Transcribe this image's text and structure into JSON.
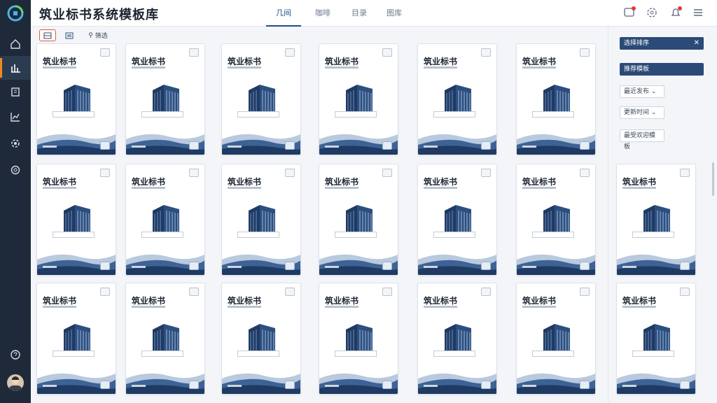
{
  "header": {
    "title": "筑业标书系统模板库",
    "tabs": [
      {
        "label": "几间",
        "active": true
      },
      {
        "label": "咖啡",
        "active": false
      },
      {
        "label": "目录",
        "active": false
      },
      {
        "label": "图库",
        "active": false
      }
    ],
    "icons": [
      "message-icon",
      "settings-icon",
      "bell-icon",
      "menu-icon"
    ]
  },
  "sidebar": {
    "logo": "app-logo",
    "items": [
      "home-icon",
      "stats-icon",
      "building-icon",
      "chart-icon",
      "gear-icon",
      "cog-icon"
    ],
    "active_index": 1,
    "bottom_icon": "help-icon"
  },
  "toolbar": {
    "view_grid_label": "",
    "view_list_label": "",
    "filter_label": "筛选"
  },
  "cards": {
    "title": "筑业标书",
    "rows": 3,
    "cols": 6,
    "extra_right_column": true
  },
  "right_panel": {
    "filter_active": "选择排序",
    "primary_button": "推荐模板",
    "select_1": "最近发布",
    "select_2": "更新时间",
    "select_3": "最受欢迎模板"
  },
  "colors": {
    "sidebar": "#1e2a3a",
    "accent": "#f28a1f",
    "brand_blue": "#2b4a77",
    "alert": "#e23a3a"
  }
}
